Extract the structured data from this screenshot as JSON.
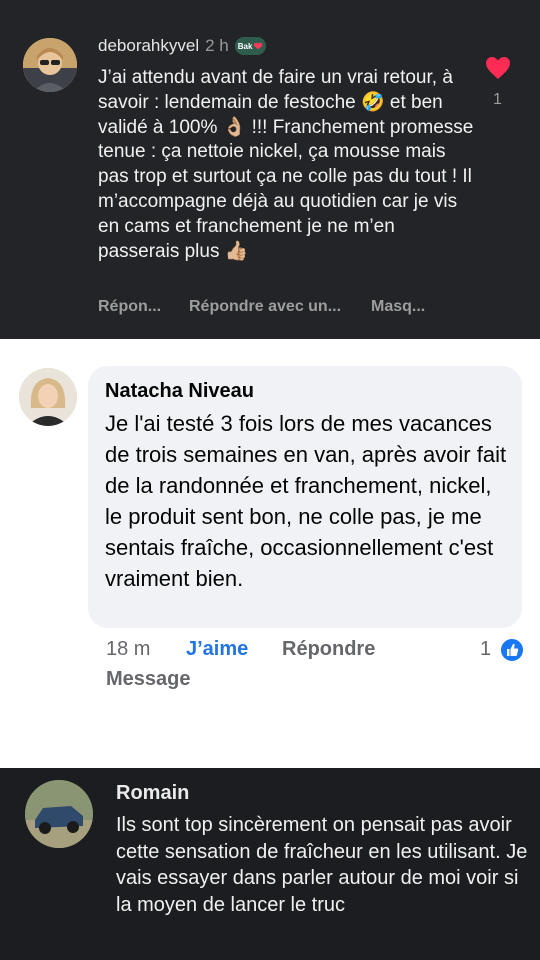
{
  "comment_1": {
    "username": "deborahkyvel",
    "time": "2 h",
    "badge": "Bak",
    "text": "J’ai attendu avant de faire un vrai retour, à savoir : lendemain de festoche 🤣 et ben validé à 100% 👌🏼 !!! Franchement promesse tenue : ça nettoie nickel, ça mousse mais pas trop et surtout ça ne colle pas du tout ! Il m’accompagne déjà au quotidien car je vis en cams et franchement je ne m’en passerais plus 👍🏼",
    "like_count": "1",
    "actions": {
      "reply": "Répon...",
      "reply_with": "Répondre avec un...",
      "hide": "Masq..."
    },
    "colors": {
      "background": "#232428",
      "heart": "#fe2c55"
    }
  },
  "comment_2": {
    "author": "Natacha Niveau",
    "text": "Je l'ai testé 3 fois lors de mes vacances de trois semaines en van, après avoir fait de la randonnée et franchement, nickel, le produit sent bon, ne colle pas, je me sentais fraîche, occasionnellement c'est vraiment bien.",
    "time": "18 m",
    "like": "J’aime",
    "reply": "Répondre",
    "message": "Message",
    "reaction_count": "1",
    "colors": {
      "bubble": "#f0f2f5",
      "like_link": "#2374e1",
      "reaction": "#1877f2"
    }
  },
  "comment_3": {
    "author": "Romain",
    "text": "Ils sont top sincèrement on pensait pas avoir cette sensation de fraîcheur en les utilisant.  Je vais essayer dans parler autour de moi voir si la moyen de lancer le truc",
    "colors": {
      "background": "#1c1d20"
    }
  },
  "icons": [
    "heart-icon",
    "thumbs-up-icon",
    "avatar-photo"
  ]
}
